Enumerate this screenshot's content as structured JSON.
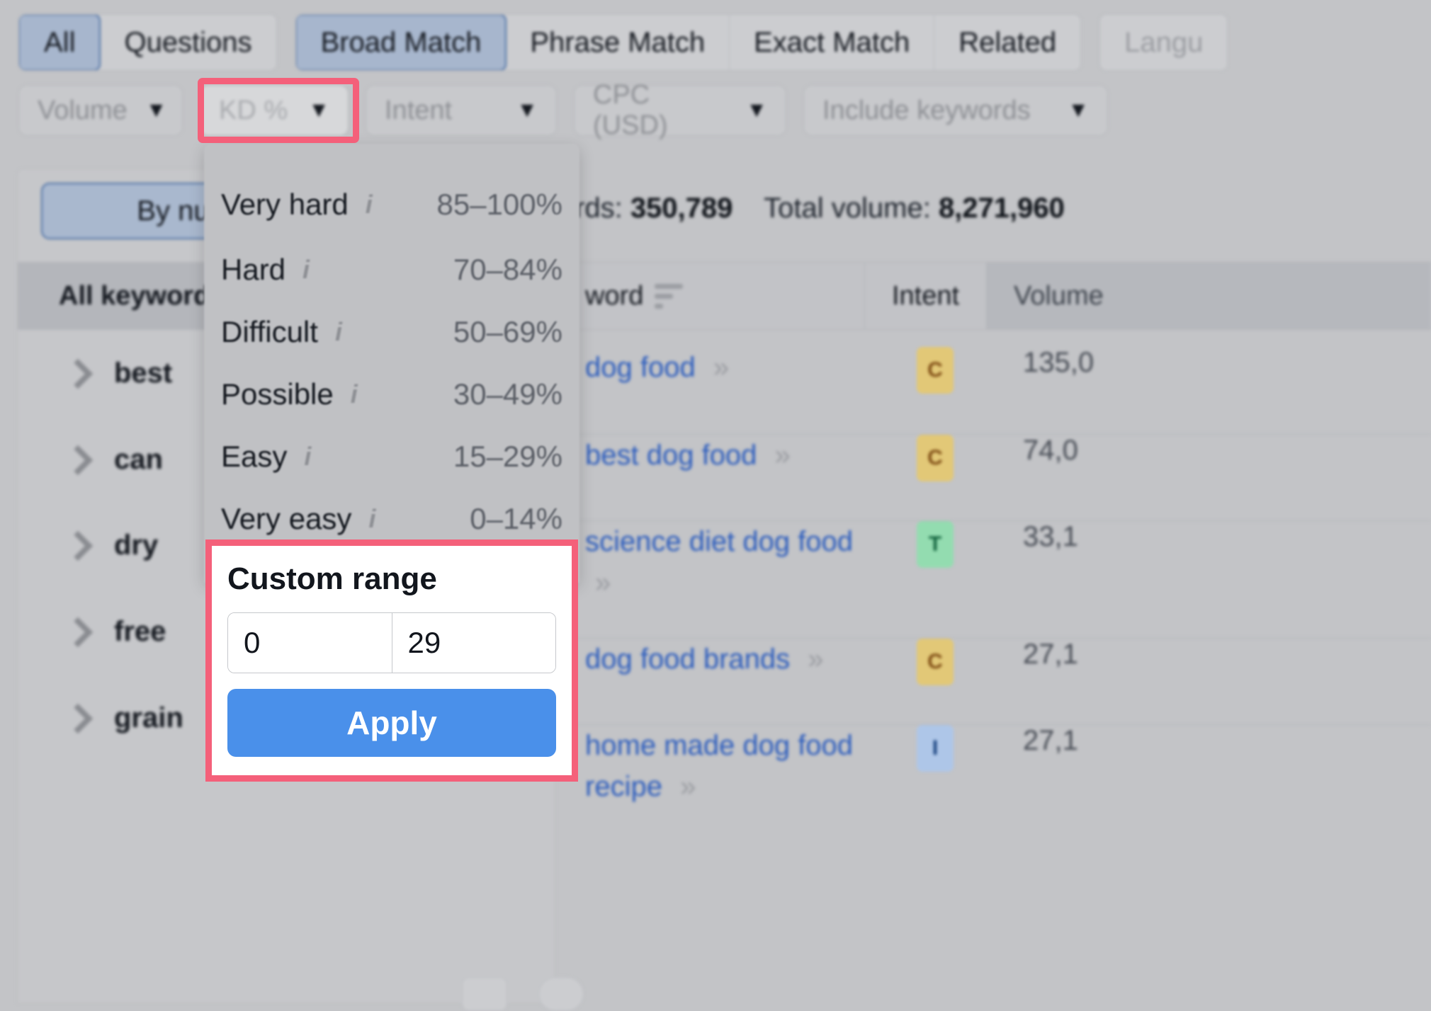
{
  "toolbar": {
    "match_tabs": [
      {
        "label": "All",
        "active": true
      },
      {
        "label": "Questions",
        "active": false
      }
    ],
    "match_types": [
      {
        "label": "Broad Match",
        "active": true
      },
      {
        "label": "Phrase Match",
        "active": false
      },
      {
        "label": "Exact Match",
        "active": false
      },
      {
        "label": "Related",
        "active": false
      }
    ],
    "language_label": "Langu",
    "filters": [
      {
        "label": "Volume",
        "state": "normal"
      },
      {
        "label": "KD %",
        "state": "highlighted"
      },
      {
        "label": "Intent",
        "state": "normal"
      },
      {
        "label": "CPC (USD)",
        "state": "normal"
      },
      {
        "label": "Include keywords",
        "state": "normal"
      }
    ],
    "chevron_icon": "chevron-down-icon"
  },
  "sidebar": {
    "group_toggle_label": "By number",
    "all_keywords_label": "All keywords",
    "items": [
      {
        "label": "best"
      },
      {
        "label": "can"
      },
      {
        "label": "dry"
      },
      {
        "label": "free"
      },
      {
        "label": "grain"
      }
    ]
  },
  "summary": {
    "keywords_label": "rds:",
    "keywords_value": "350,789",
    "volume_label": "Total volume:",
    "volume_value": "8,271,960"
  },
  "table": {
    "headers": [
      {
        "label": "word",
        "sort_icon": "sort-icon"
      },
      {
        "label": "Intent"
      },
      {
        "label": "Volume"
      }
    ],
    "rows": [
      {
        "keyword": "dog food",
        "expand_icon": "double-chevron-right-icon",
        "intent": "C",
        "volume": "135,0"
      },
      {
        "keyword": "best dog food",
        "expand_icon": "double-chevron-right-icon",
        "intent": "C",
        "volume": "74,0"
      },
      {
        "keyword": "science diet dog food",
        "expand_icon": "double-chevron-right-icon",
        "intent": "T",
        "volume": "33,1"
      },
      {
        "keyword": "dog food brands",
        "expand_icon": "double-chevron-right-icon",
        "intent": "C",
        "volume": "27,1"
      },
      {
        "keyword": "home made dog food recipe",
        "expand_icon": "double-chevron-right-icon",
        "intent": "I",
        "volume": "27,1"
      }
    ]
  },
  "kd_dropdown": {
    "info_icon": "info-icon",
    "options": [
      {
        "label": "Very hard",
        "range": "85–100%"
      },
      {
        "label": "Hard",
        "range": "70–84%"
      },
      {
        "label": "Difficult",
        "range": "50–69%"
      },
      {
        "label": "Possible",
        "range": "30–49%"
      },
      {
        "label": "Easy",
        "range": "15–29%"
      },
      {
        "label": "Very easy",
        "range": "0–14%"
      }
    ],
    "custom_range": {
      "title": "Custom range",
      "min_value": "0",
      "max_value": "29",
      "apply_label": "Apply"
    }
  },
  "colors": {
    "highlight": "#f4607a",
    "apply_button": "#4a90ea",
    "link": "#2a5bbd",
    "intent_c": "#e2c877",
    "intent_t": "#93dcb0",
    "intent_i": "#aec6e8",
    "active_tab": "#a7b6cd"
  }
}
